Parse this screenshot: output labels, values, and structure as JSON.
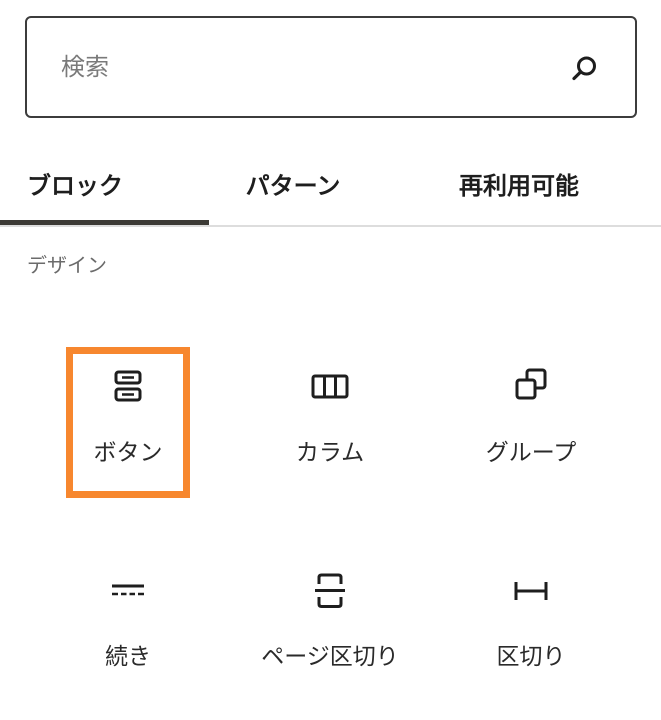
{
  "search": {
    "placeholder": "検索",
    "value": ""
  },
  "tabs": [
    {
      "label": "ブロック",
      "active": true
    },
    {
      "label": "パターン",
      "active": false
    },
    {
      "label": "再利用可能",
      "active": false
    }
  ],
  "category": {
    "label": "デザイン"
  },
  "blocks": [
    {
      "label": "ボタン",
      "icon": "buttons-icon",
      "highlighted": true
    },
    {
      "label": "カラム",
      "icon": "columns-icon"
    },
    {
      "label": "グループ",
      "icon": "group-icon"
    },
    {
      "label": "続き",
      "icon": "more-icon"
    },
    {
      "label": "ページ区切り",
      "icon": "page-break-icon"
    },
    {
      "label": "区切り",
      "icon": "separator-icon"
    }
  ],
  "colors": {
    "highlight": "#f7872e",
    "active_tab_indicator": "#3c3a35",
    "border": "#3c3c3c"
  }
}
